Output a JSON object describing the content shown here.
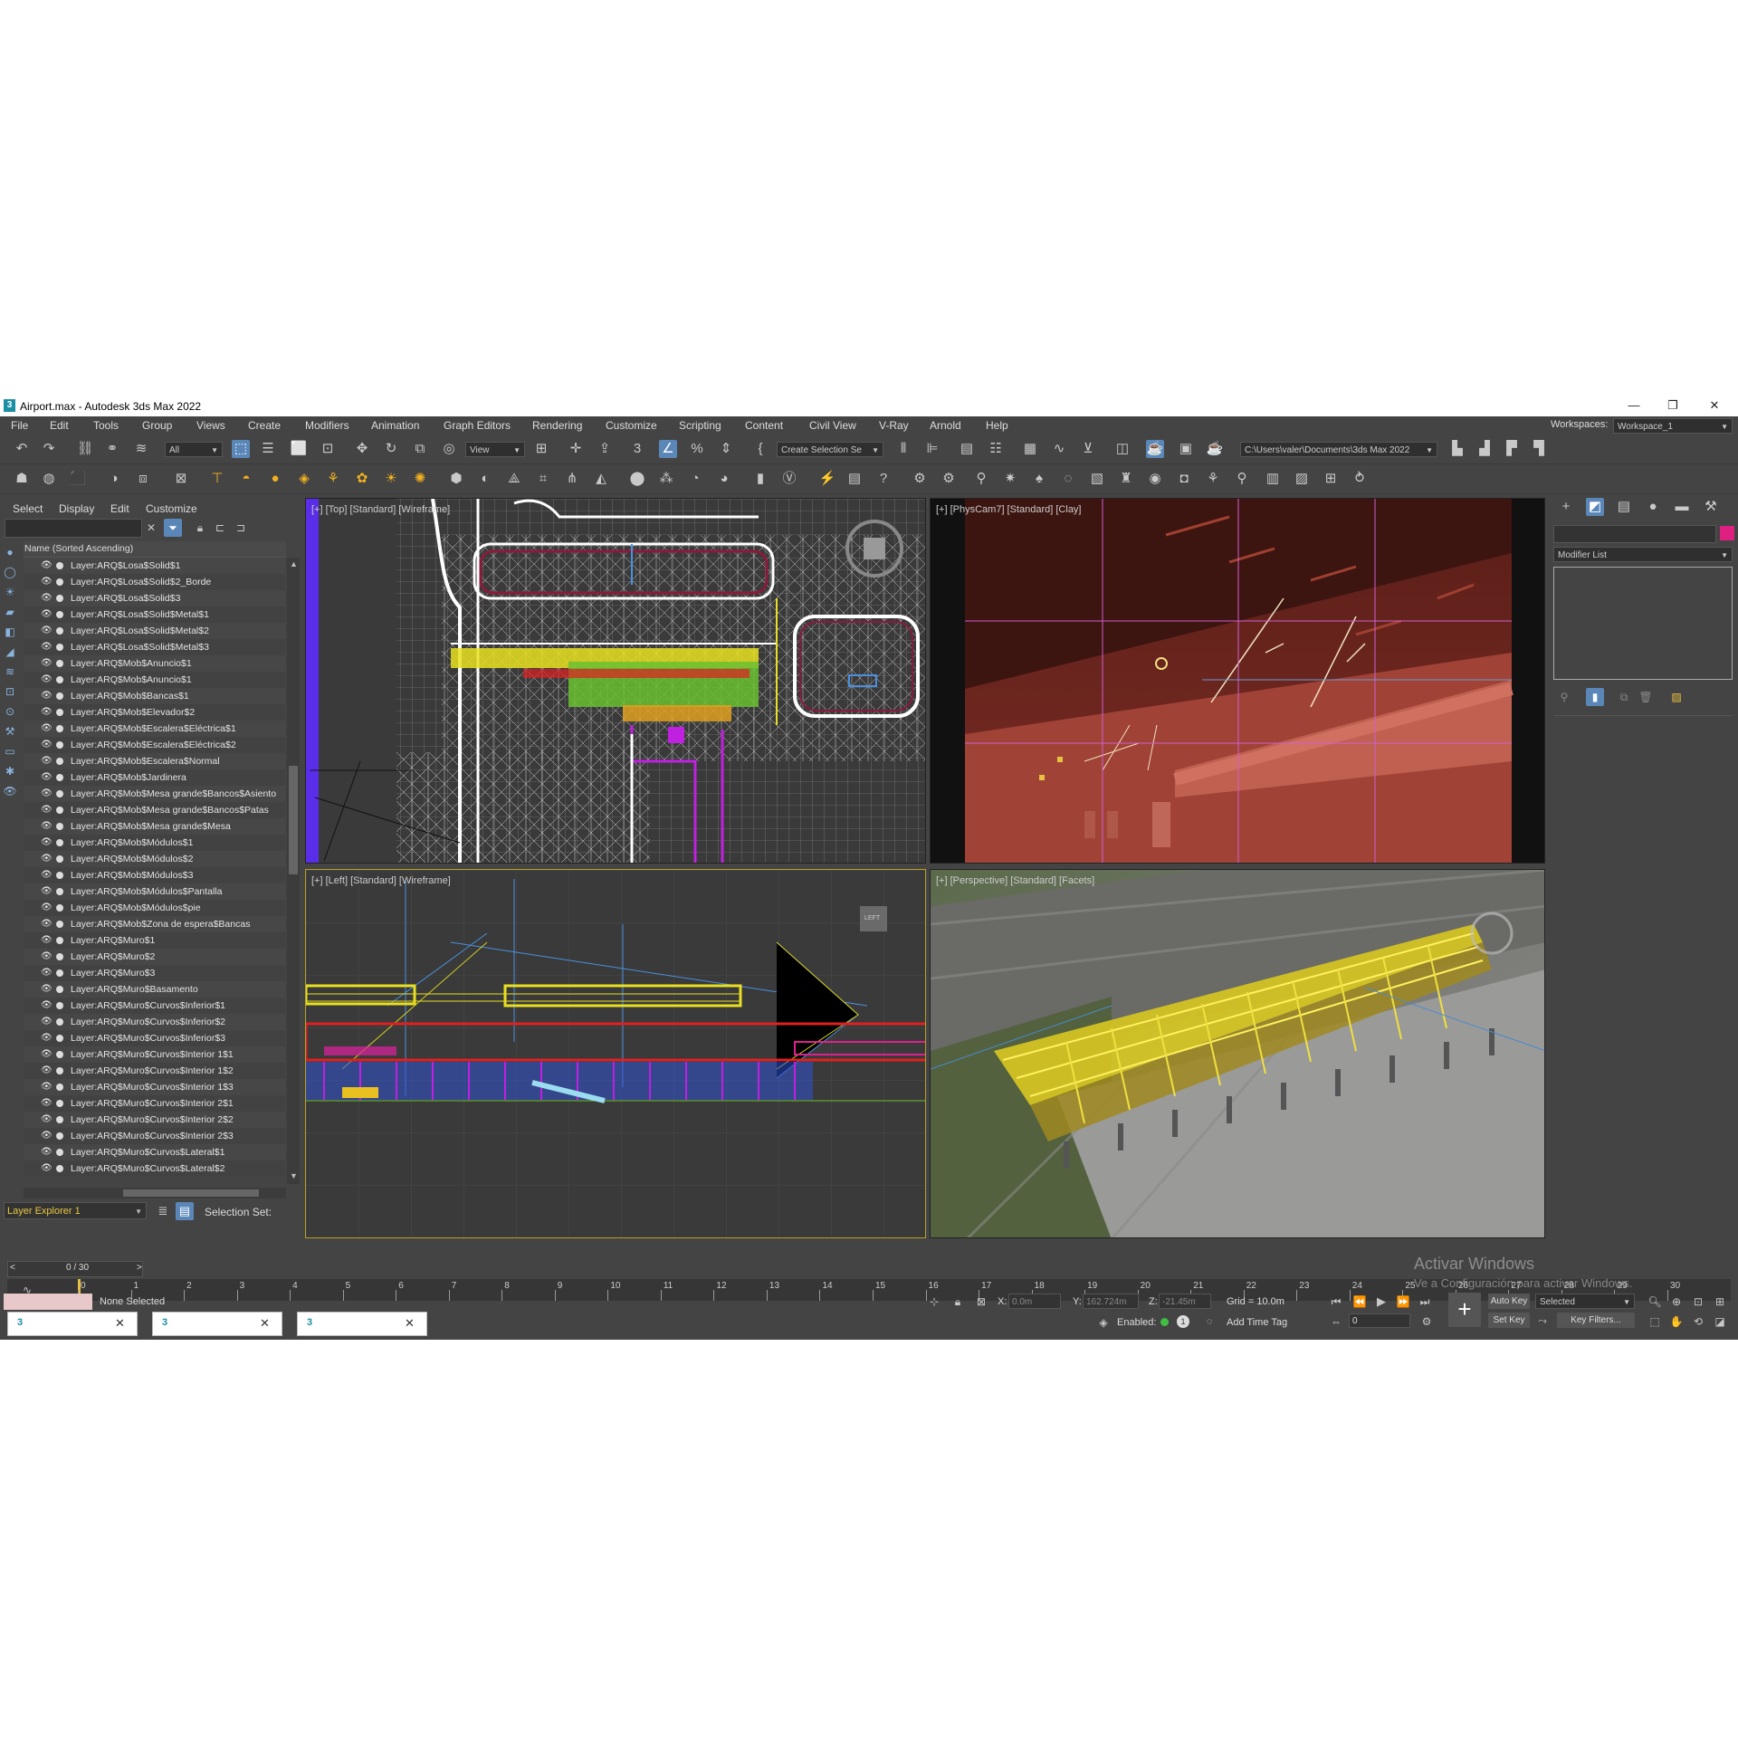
{
  "window": {
    "title": "Airport.max - Autodesk 3ds Max 2022",
    "app_icon": "3"
  },
  "menu": [
    "File",
    "Edit",
    "Tools",
    "Group",
    "Views",
    "Create",
    "Modifiers",
    "Animation",
    "Graph Editors",
    "Rendering",
    "Customize",
    "Scripting",
    "Content",
    "Civil View",
    "V-Ray",
    "Arnold",
    "Help"
  ],
  "workspaces": {
    "label": "Workspaces:",
    "value": "Workspace_1"
  },
  "toolbar": {
    "filter_value": "All",
    "refcoord_value": "View",
    "selection_set_placeholder": "Create Selection Se",
    "project_path": "C:\\Users\\valer\\Documents\\3ds Max 2022"
  },
  "explorer": {
    "menu": [
      "Select",
      "Display",
      "Edit",
      "Customize"
    ],
    "column_header": "Name (Sorted Ascending)",
    "layers": [
      "Layer:ARQ$Losa$Solid$1",
      "Layer:ARQ$Losa$Solid$2_Borde",
      "Layer:ARQ$Losa$Solid$3",
      "Layer:ARQ$Losa$Solid$Metal$1",
      "Layer:ARQ$Losa$Solid$Metal$2",
      "Layer:ARQ$Losa$Solid$Metal$3",
      "Layer:ARQ$Mob$Anuncio$1",
      "Layer:ARQ$Mob$Anuncio$1",
      "Layer:ARQ$Mob$Bancas$1",
      "Layer:ARQ$Mob$Elevador$2",
      "Layer:ARQ$Mob$Escalera$Eléctrica$1",
      "Layer:ARQ$Mob$Escalera$Eléctrica$2",
      "Layer:ARQ$Mob$Escalera$Normal",
      "Layer:ARQ$Mob$Jardinera",
      "Layer:ARQ$Mob$Mesa grande$Bancos$Asiento",
      "Layer:ARQ$Mob$Mesa grande$Bancos$Patas",
      "Layer:ARQ$Mob$Mesa grande$Mesa",
      "Layer:ARQ$Mob$Módulos$1",
      "Layer:ARQ$Mob$Módulos$2",
      "Layer:ARQ$Mob$Módulos$3",
      "Layer:ARQ$Mob$Módulos$Pantalla",
      "Layer:ARQ$Mob$Módulos$pie",
      "Layer:ARQ$Mob$Zona de espera$Bancas",
      "Layer:ARQ$Muro$1",
      "Layer:ARQ$Muro$2",
      "Layer:ARQ$Muro$3",
      "Layer:ARQ$Muro$Basamento",
      "Layer:ARQ$Muro$Curvos$Inferior$1",
      "Layer:ARQ$Muro$Curvos$Inferior$2",
      "Layer:ARQ$Muro$Curvos$Inferior$3",
      "Layer:ARQ$Muro$Curvos$Interior 1$1",
      "Layer:ARQ$Muro$Curvos$Interior 1$2",
      "Layer:ARQ$Muro$Curvos$Interior 1$3",
      "Layer:ARQ$Muro$Curvos$Interior 2$1",
      "Layer:ARQ$Muro$Curvos$Interior 2$2",
      "Layer:ARQ$Muro$Curvos$Interior 2$3",
      "Layer:ARQ$Muro$Curvos$Lateral$1",
      "Layer:ARQ$Muro$Curvos$Lateral$2"
    ],
    "explorer_name": "Layer Explorer 1",
    "selection_set_label": "Selection Set:"
  },
  "viewports": {
    "top": "[+] [Top] [Standard] [Wireframe]",
    "physcam": "[+] [PhysCam7] [Standard] [Clay]",
    "left": "[+] [Left] [Standard] [Wireframe]",
    "perspective": "[+] [Perspective] [Standard] [Facets]",
    "left_cube": "LEFT"
  },
  "command_panel": {
    "modifier_list": "Modifier List"
  },
  "timeline": {
    "frame_counter": "0 / 30",
    "prev": "<",
    "next": ">",
    "ticks": [
      "0",
      "1",
      "2",
      "3",
      "4",
      "5",
      "6",
      "7",
      "8",
      "9",
      "10",
      "11",
      "12",
      "13",
      "14",
      "15",
      "16",
      "17",
      "18",
      "19",
      "20",
      "21",
      "22",
      "23",
      "24",
      "25",
      "26",
      "27",
      "28",
      "29",
      "30"
    ]
  },
  "status": {
    "selection": "None Selected",
    "x_label": "X:",
    "x_value": "0.0m",
    "y_label": "Y:",
    "y_value": "162.724m",
    "z_label": "Z:",
    "z_value": "-21.45m",
    "grid": "Grid = 10.0m",
    "enabled": "Enabled:",
    "add_time_tag": "Add Time Tag",
    "auto_key": "Auto Key",
    "set_key": "Set Key",
    "key_mode": "Selected",
    "key_filters": "Key Filters...",
    "frame_field": "0"
  },
  "watermark": {
    "line1": "Activar Windows",
    "line2": "Ve a Configuración para activar Windows."
  },
  "colors": {
    "accent": "#5a87b8",
    "ui_bg": "#444444",
    "viewport_bg": "#3a3a3a",
    "clay": "#9b3f35",
    "wire_yellow": "#e8e020"
  }
}
